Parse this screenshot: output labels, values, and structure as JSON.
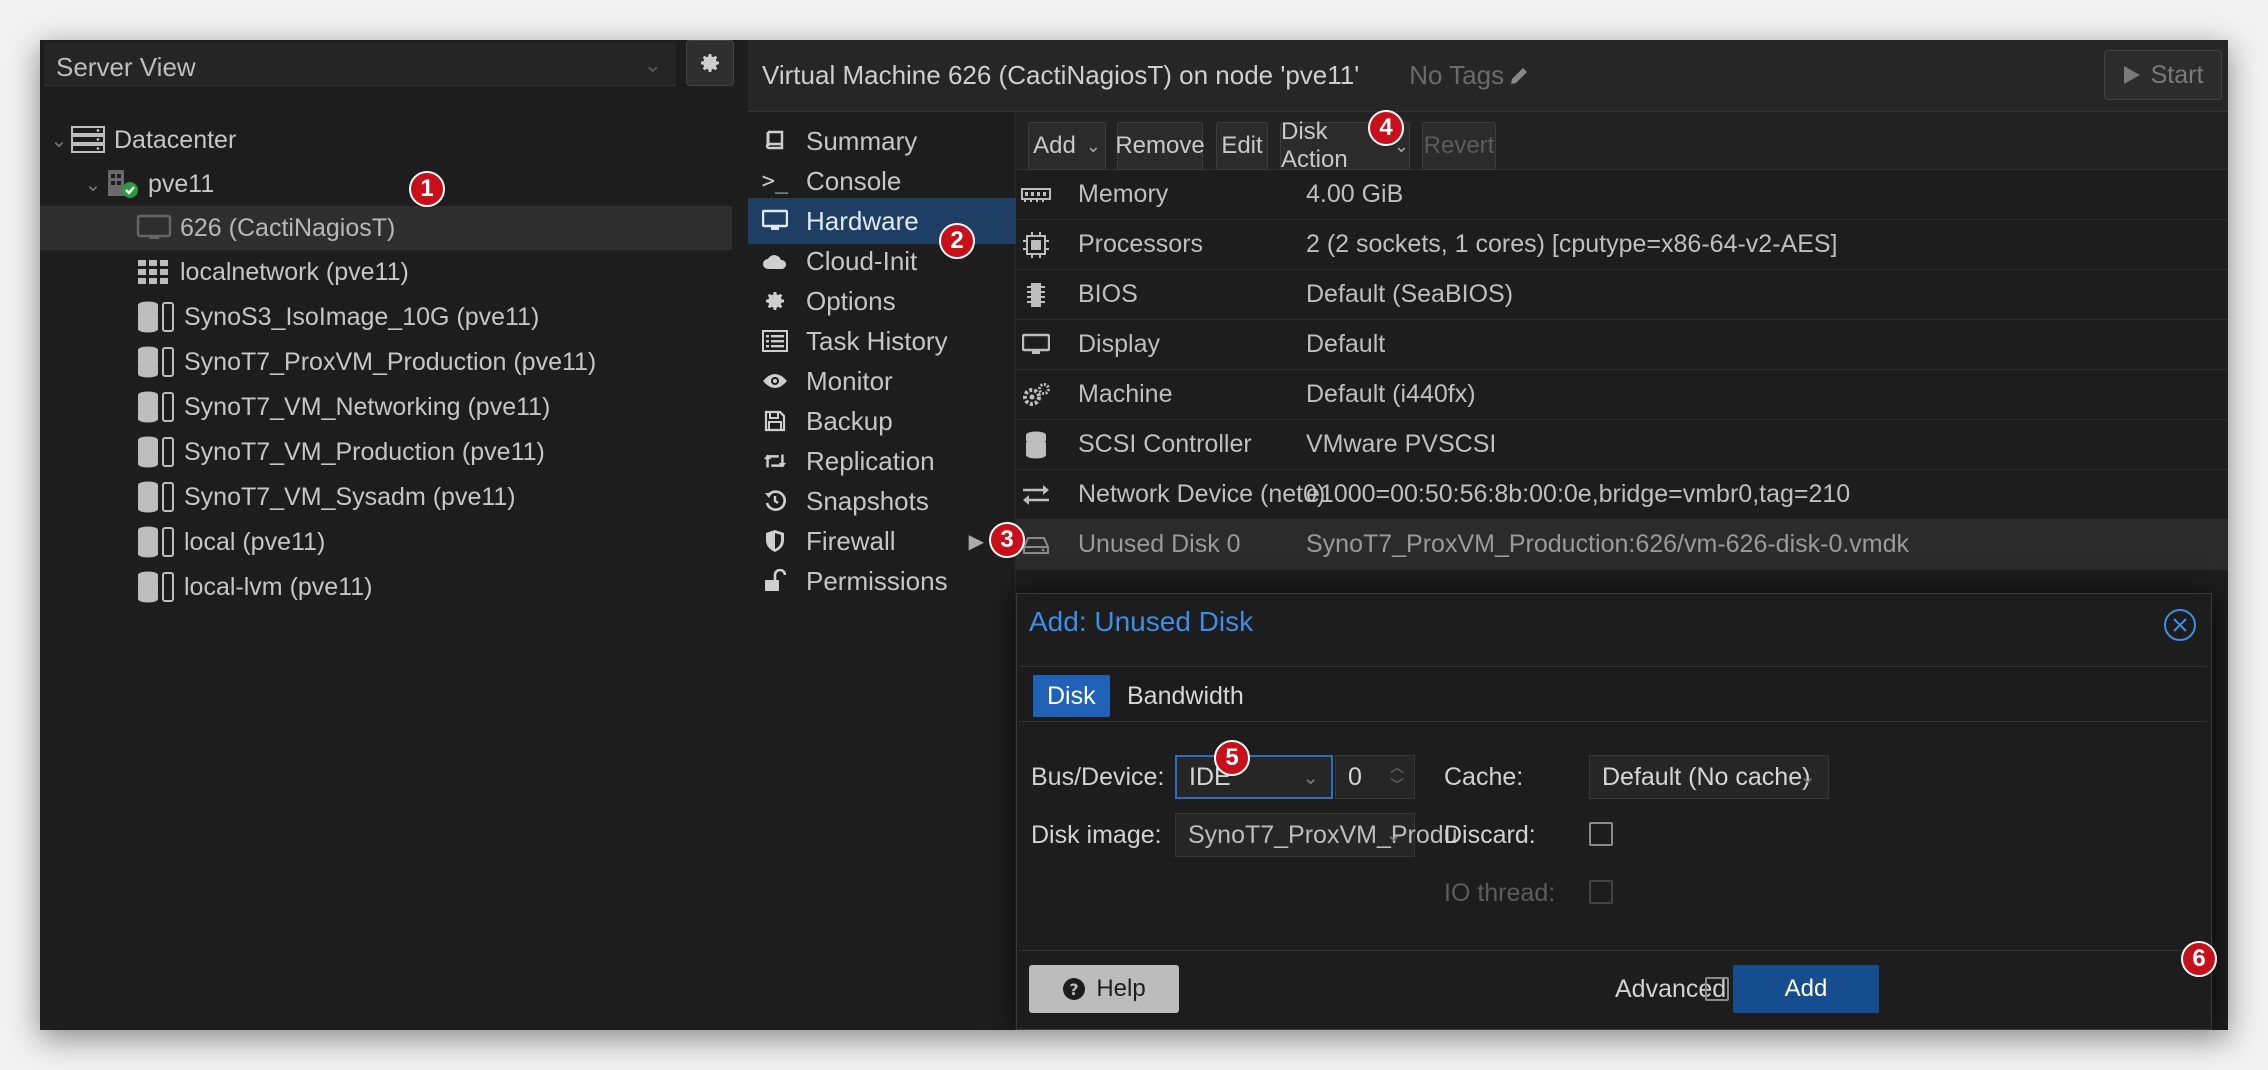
{
  "server_view": {
    "label": "Server View"
  },
  "tree": [
    {
      "label": "Datacenter",
      "icon": "datacenter-icon",
      "toggle": "⌄"
    },
    {
      "label": "pve11",
      "icon": "node-icon",
      "toggle": "⌄"
    },
    {
      "label": "626 (CactiNagiosT)",
      "icon": "vm-monitor-icon",
      "selected": true
    },
    {
      "label": "localnetwork (pve11)",
      "icon": "sdn-grid-icon"
    },
    {
      "label": "SynoS3_IsoImage_10G (pve11)",
      "icon": "storage-icon"
    },
    {
      "label": "SynoT7_ProxVM_Production (pve11)",
      "icon": "storage-icon"
    },
    {
      "label": "SynoT7_VM_Networking (pve11)",
      "icon": "storage-icon"
    },
    {
      "label": "SynoT7_VM_Production (pve11)",
      "icon": "storage-icon"
    },
    {
      "label": "SynoT7_VM_Sysadm (pve11)",
      "icon": "storage-icon"
    },
    {
      "label": "local (pve11)",
      "icon": "storage-icon"
    },
    {
      "label": "local-lvm (pve11)",
      "icon": "storage-icon"
    }
  ],
  "header": {
    "title": "Virtual Machine 626 (CactiNagiosT) on node 'pve11'",
    "tags": "No Tags",
    "start_label": "Start"
  },
  "nav": [
    {
      "label": "Summary",
      "icon": "book-icon"
    },
    {
      "label": "Console",
      "icon": "terminal-icon"
    },
    {
      "label": "Hardware",
      "icon": "desktop-icon",
      "active": true
    },
    {
      "label": "Cloud-Init",
      "icon": "cloud-icon"
    },
    {
      "label": "Options",
      "icon": "gear-icon"
    },
    {
      "label": "Task History",
      "icon": "list-icon"
    },
    {
      "label": "Monitor",
      "icon": "eye-icon"
    },
    {
      "label": "Backup",
      "icon": "floppy-icon"
    },
    {
      "label": "Replication",
      "icon": "retweet-icon"
    },
    {
      "label": "Snapshots",
      "icon": "history-icon"
    },
    {
      "label": "Firewall",
      "icon": "shield-icon",
      "has_submenu": true
    },
    {
      "label": "Permissions",
      "icon": "unlock-icon"
    }
  ],
  "toolbar": {
    "add": "Add",
    "remove": "Remove",
    "edit": "Edit",
    "disk_action": "Disk Action",
    "revert": "Revert"
  },
  "hardware": [
    {
      "name": "Memory",
      "value": "4.00 GiB",
      "icon": "memory-icon"
    },
    {
      "name": "Processors",
      "value": "2 (2 sockets, 1 cores) [cputype=x86-64-v2-AES]",
      "icon": "cpu-icon"
    },
    {
      "name": "BIOS",
      "value": "Default (SeaBIOS)",
      "icon": "microchip-icon"
    },
    {
      "name": "Display",
      "value": "Default",
      "icon": "display-icon"
    },
    {
      "name": "Machine",
      "value": "Default (i440fx)",
      "icon": "cogs-icon"
    },
    {
      "name": "SCSI Controller",
      "value": "VMware PVSCSI",
      "icon": "database-icon"
    },
    {
      "name": "Network Device (net0)",
      "value": "e1000=00:50:56:8b:00:0e,bridge=vmbr0,tag=210",
      "icon": "exchange-icon"
    },
    {
      "name": "Unused Disk 0",
      "value": "SynoT7_ProxVM_Production:626/vm-626-disk-0.vmdk",
      "icon": "hdd-icon",
      "selected": true
    }
  ],
  "modal": {
    "title": "Add: Unused Disk",
    "tabs": [
      "Disk",
      "Bandwidth"
    ],
    "bus_device_label": "Bus/Device:",
    "bus_value": "IDE",
    "device_index": "0",
    "disk_image_label": "Disk image:",
    "disk_image_value": "SynoT7_ProxVM_Produ",
    "cache_label": "Cache:",
    "cache_value": "Default (No cache)",
    "discard_label": "Discard:",
    "io_thread_label": "IO thread:",
    "help_label": "Help",
    "advanced_label": "Advanced",
    "add_label": "Add"
  },
  "markers": [
    "1",
    "2",
    "3",
    "4",
    "5",
    "6"
  ],
  "colors": {
    "accent": "#1f62b8",
    "title_blue": "#3d8ee8",
    "marker_red": "#c8101a",
    "nav_active": "#1f3e63"
  }
}
